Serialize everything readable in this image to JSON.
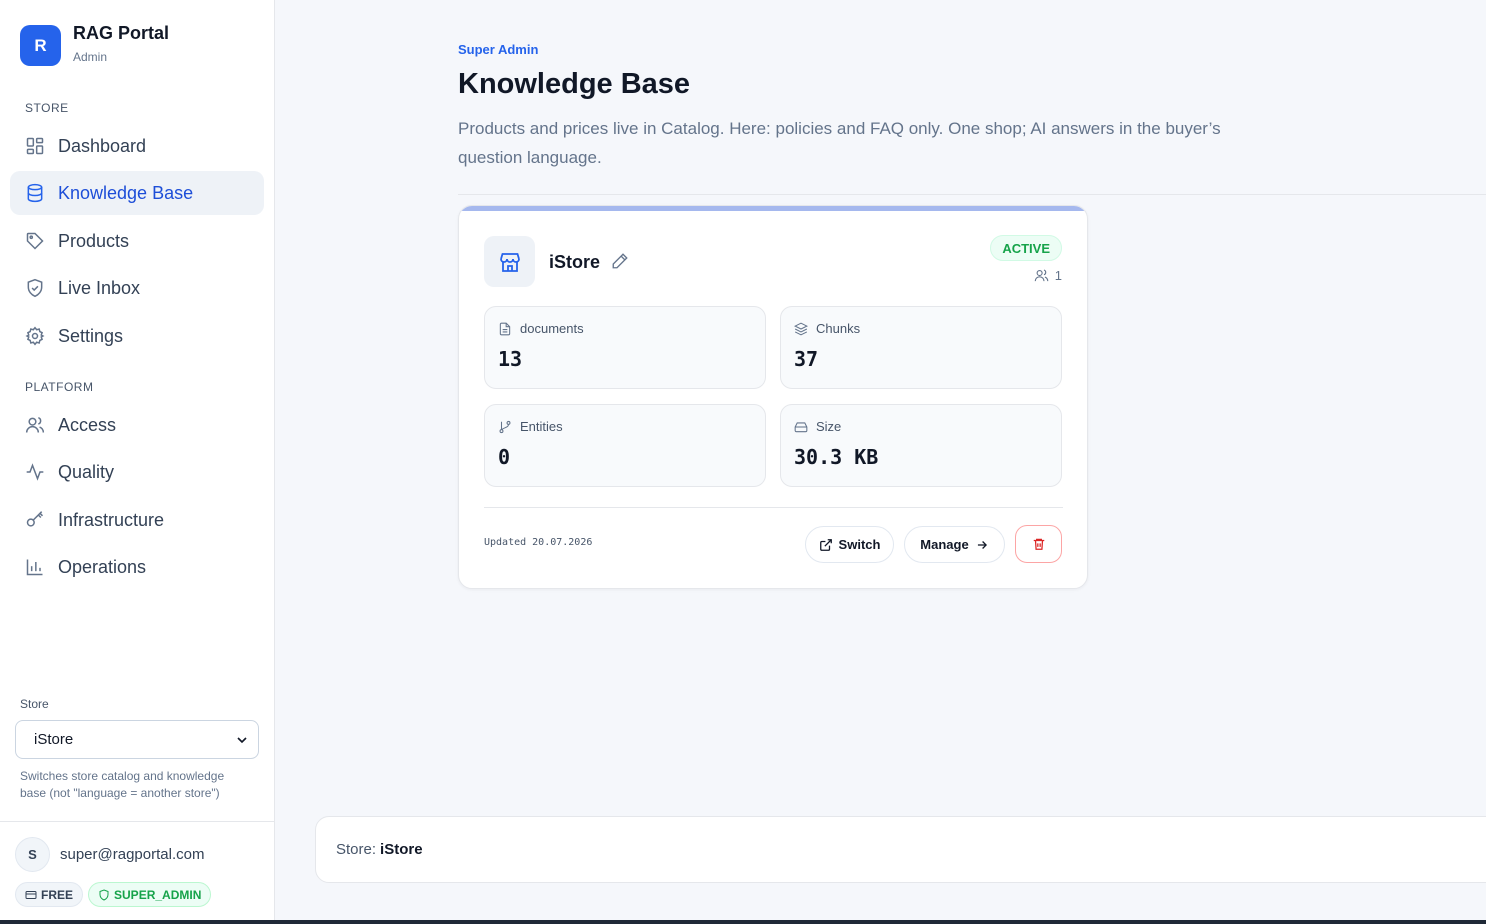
{
  "brand": {
    "logo_letter": "R",
    "title": "RAG Portal",
    "subtitle": "Admin"
  },
  "sidebar": {
    "sections": [
      {
        "title": "STORE",
        "items": [
          {
            "label": "Dashboard",
            "icon": "dashboard-grid-icon",
            "active": false
          },
          {
            "label": "Knowledge Base",
            "icon": "database-icon",
            "active": true
          },
          {
            "label": "Products",
            "icon": "tag-icon",
            "active": false
          },
          {
            "label": "Live Inbox",
            "icon": "shield-check-icon",
            "active": false
          },
          {
            "label": "Settings",
            "icon": "gear-icon",
            "active": false
          }
        ]
      },
      {
        "title": "PLATFORM",
        "items": [
          {
            "label": "Access",
            "icon": "users-icon",
            "active": false
          },
          {
            "label": "Quality",
            "icon": "activity-icon",
            "active": false
          },
          {
            "label": "Infrastructure",
            "icon": "key-icon",
            "active": false
          },
          {
            "label": "Operations",
            "icon": "bar-chart-icon",
            "active": false
          }
        ]
      }
    ],
    "store_selector": {
      "label": "Store",
      "selected": "iStore",
      "hint": "Switches store catalog and knowledge base (not \"language = another store\")"
    },
    "user": {
      "avatar_letter": "S",
      "email": "super@ragportal.com",
      "plan_badge": "FREE",
      "role_badge": "SUPER_ADMIN"
    }
  },
  "header": {
    "eyebrow": "Super Admin",
    "title": "Knowledge Base",
    "description": "Products and prices live in Catalog. Here: policies and FAQ only. One shop; AI answers in the buyer’s question language."
  },
  "store_card": {
    "name": "iStore",
    "status": "ACTIVE",
    "members_count": "1",
    "stats": [
      {
        "label": "documents",
        "value": "13",
        "icon": "file-text-icon"
      },
      {
        "label": "Chunks",
        "value": "37",
        "icon": "layers-icon"
      },
      {
        "label": "Entities",
        "value": "0",
        "icon": "git-branch-icon"
      },
      {
        "label": "Size",
        "value": "30.3 KB",
        "icon": "hard-drive-icon"
      }
    ],
    "updated_label": "Updated",
    "updated_date": "20.07.2026",
    "actions": {
      "switch": "Switch",
      "manage": "Manage"
    }
  },
  "footer": {
    "store_prefix": "Store:",
    "store_name": "iStore"
  },
  "colors": {
    "accent": "#2563eb",
    "active_bg": "#eef2f7",
    "success": "#16a34a",
    "danger": "#dc2626"
  }
}
